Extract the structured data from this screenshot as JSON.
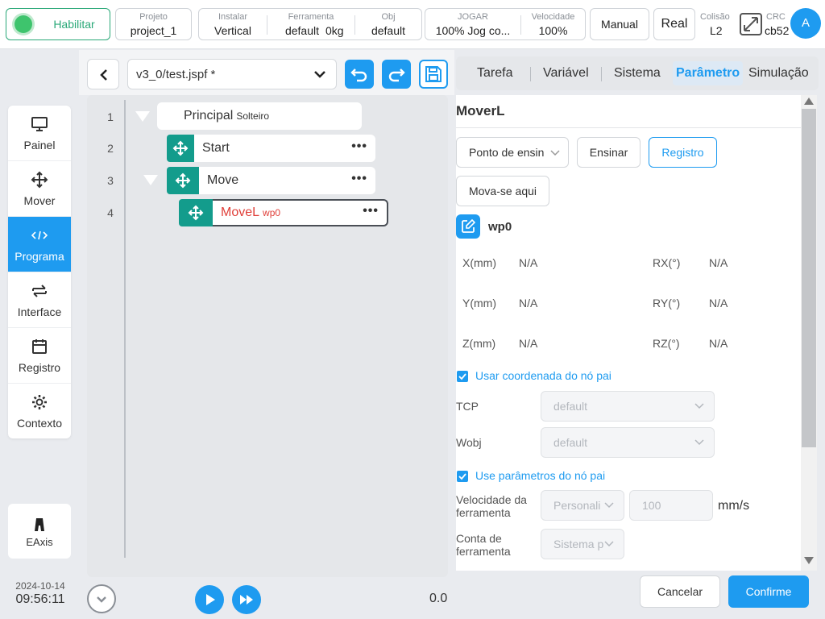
{
  "topbar": {
    "enable_label": "Habilitar",
    "project_key": "Projeto",
    "project_value": "project_1",
    "install_key": "Instalar",
    "install_value": "Vertical",
    "tool_key": "Ferramenta",
    "tool_value": "default",
    "tool_mass": "0kg",
    "obj_key": "Obj",
    "obj_value": "default",
    "play_key": "JOGAR",
    "play_value": "100%  Jog co...",
    "speed_key": "Velocidade",
    "speed_value": "100%",
    "mode_button": "Manual",
    "real_button": "Real",
    "collision_key": "Colisão",
    "collision_value": "L2",
    "crc_key": "CRC",
    "crc_value": "cb52",
    "avatar_letter": "A"
  },
  "nav": {
    "items": [
      {
        "label": "Painel",
        "icon": "monitor-icon"
      },
      {
        "label": "Mover",
        "icon": "move-arrows-icon"
      },
      {
        "label": "Programa",
        "icon": "code-icon"
      },
      {
        "label": "Interface",
        "icon": "swap-icon"
      },
      {
        "label": "Registro",
        "icon": "calendar-icon"
      },
      {
        "label": "Contexto",
        "icon": "gear-icon"
      }
    ],
    "active": "Programa",
    "eaxis_label": "EAxis"
  },
  "datetime": {
    "date": "2024-10-14",
    "time": "09:56:11"
  },
  "editor": {
    "filename": "v3_0/test.jspf *",
    "lines": [
      "1",
      "2",
      "3",
      "4"
    ],
    "nodes": [
      {
        "name": "Principal",
        "sub": "Solteiro"
      },
      {
        "name": "Start"
      },
      {
        "name": "Move"
      },
      {
        "name": "MoveL",
        "sub": "wp0"
      }
    ],
    "more_glyph": "•••",
    "speed_readout": "0.0"
  },
  "tabs": [
    "Tarefa",
    "Variável",
    "Sistema",
    "Parâmetro",
    "Simulação"
  ],
  "active_tab": "Parâmetro",
  "param": {
    "title": "MoverL",
    "teach_point_select": "Ponto de ensin",
    "teach_button": "Ensinar",
    "record_button": "Registro",
    "move_here_button": "Mova-se aqui",
    "waypoint": "wp0",
    "coords": [
      {
        "k": "X(mm)",
        "v": "N/A"
      },
      {
        "k": "RX(°)",
        "v": "N/A"
      },
      {
        "k": "Y(mm)",
        "v": "N/A"
      },
      {
        "k": "RY(°)",
        "v": "N/A"
      },
      {
        "k": "Z(mm)",
        "v": "N/A"
      },
      {
        "k": "RZ(°)",
        "v": "N/A"
      }
    ],
    "use_parent_coord": "Usar coordenada do nó pai",
    "tcp_label": "TCP",
    "tcp_value": "default",
    "wobj_label": "Wobj",
    "wobj_value": "default",
    "use_parent_params": "Use parâmetros do nó pai",
    "tool_speed_label_1": "Velocidade da",
    "tool_speed_label_2": "ferramenta",
    "tool_speed_mode": "Personali",
    "tool_speed_value": "100",
    "tool_speed_unit": "mm/s",
    "tool_account_label_1": "Conta de",
    "tool_account_label_2": "ferramenta",
    "tool_account_value": "Sistema p"
  },
  "footer": {
    "cancel": "Cancelar",
    "confirm": "Confirme"
  },
  "colors": {
    "accent": "#1e9bf0",
    "teal": "#139c8c",
    "green": "#2aa878",
    "error_red": "#e0403a"
  }
}
